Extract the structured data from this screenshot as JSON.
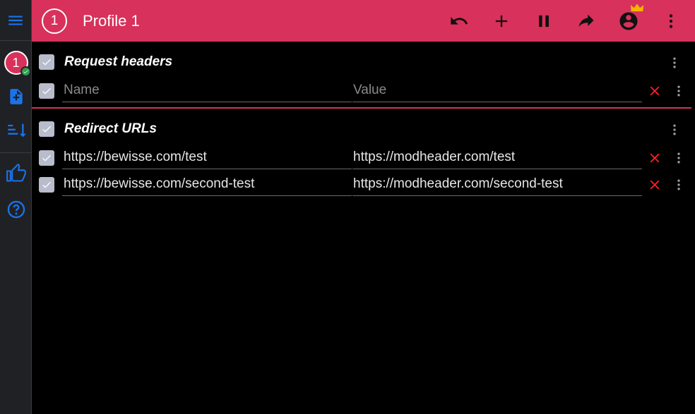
{
  "sidebar": {
    "items": [
      {
        "name": "menu-icon"
      },
      {
        "name": "profile-badge",
        "label": "1"
      },
      {
        "name": "add-profile-icon"
      },
      {
        "name": "sort-icon"
      },
      {
        "name": "thumbs-up-icon"
      },
      {
        "name": "help-icon"
      }
    ]
  },
  "header": {
    "profile_number": "1",
    "title": "Profile 1",
    "actions": [
      "undo-icon",
      "add-icon",
      "pause-icon",
      "share-icon",
      "account-icon",
      "more-icon"
    ]
  },
  "sections": [
    {
      "title": "Request headers",
      "rows": [
        {
          "name": "",
          "value": "",
          "name_placeholder": "Name",
          "value_placeholder": "Value"
        }
      ]
    },
    {
      "title": "Redirect URLs",
      "rows": [
        {
          "name": "https://bewisse.com/test",
          "value": "https://modheader.com/test"
        },
        {
          "name": "https://bewisse.com/second-test",
          "value": "https://modheader.com/second-test"
        }
      ]
    }
  ],
  "colors": {
    "accent": "#d8315b",
    "sidebar_bg": "#202124",
    "icon_blue": "#1a73e8",
    "delete_red": "#ff2020",
    "crown": "#f4b400"
  }
}
